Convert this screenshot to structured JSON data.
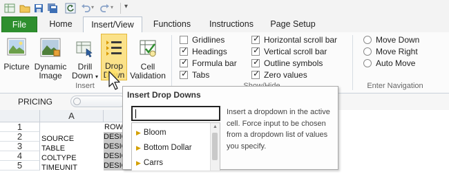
{
  "quick_access": {
    "icons": [
      "excel-app-icon",
      "open-folder-icon",
      "save-icon",
      "save-all-icon",
      "refresh-icon",
      "undo-icon",
      "redo-icon",
      "customize-toolbar-icon"
    ]
  },
  "tabs": [
    {
      "label": "File"
    },
    {
      "label": "Home"
    },
    {
      "label": "Insert/View"
    },
    {
      "label": "Functions"
    },
    {
      "label": "Instructions"
    },
    {
      "label": "Page Setup"
    }
  ],
  "ribbon": {
    "insert_group": {
      "label": "Insert",
      "picture": "Picture",
      "dynamic_image_line1": "Dynamic",
      "dynamic_image_line2": "Image",
      "drill_down_line1": "Drill",
      "drill_down_line2": "Down",
      "drop_down_line1": "Drop",
      "drop_down_line2": "Down",
      "cell_validation_line1": "Cell",
      "cell_validation_line2": "Validation"
    },
    "show_hide_group": {
      "label": "Show/Hide",
      "options": [
        {
          "label": "Gridlines",
          "checked": false
        },
        {
          "label": "Headings",
          "checked": true
        },
        {
          "label": "Formula bar",
          "checked": true
        },
        {
          "label": "Tabs",
          "checked": true
        },
        {
          "label": "Horizontal scroll bar",
          "checked": true
        },
        {
          "label": "Vertical scroll bar",
          "checked": true
        },
        {
          "label": "Outline symbols",
          "checked": true
        },
        {
          "label": "Zero values",
          "checked": true
        }
      ]
    },
    "navigation_group": {
      "label": "Enter Navigation",
      "options": [
        {
          "label": "Move Down"
        },
        {
          "label": "Move Right"
        },
        {
          "label": "Auto Move"
        }
      ]
    }
  },
  "name_box": {
    "value": "PRICING"
  },
  "grid": {
    "column_header": "A",
    "rows": [
      {
        "num": "1",
        "a": "",
        "b": "ROW"
      },
      {
        "num": "2",
        "a": "SOURCE",
        "b": "DESIGN"
      },
      {
        "num": "3",
        "a": "TABLE",
        "b": "DESIGN"
      },
      {
        "num": "4",
        "a": "COLTYPE",
        "b": "DESIGN"
      },
      {
        "num": "5",
        "a": "TIMEUNIT",
        "b": "DESIGN"
      }
    ]
  },
  "tooltip": {
    "title": "Insert Drop Downs",
    "input_value": "",
    "items": [
      "Bloom",
      "Bottom Dollar",
      "Carrs"
    ],
    "description": "Insert a dropdown in the active cell. Force input to be chosen from a dropdown list of values you specify."
  },
  "colors": {
    "file_tab": "#2e8f2e",
    "highlight": "#fbe28a",
    "cell_gray": "#c8c8c8"
  }
}
